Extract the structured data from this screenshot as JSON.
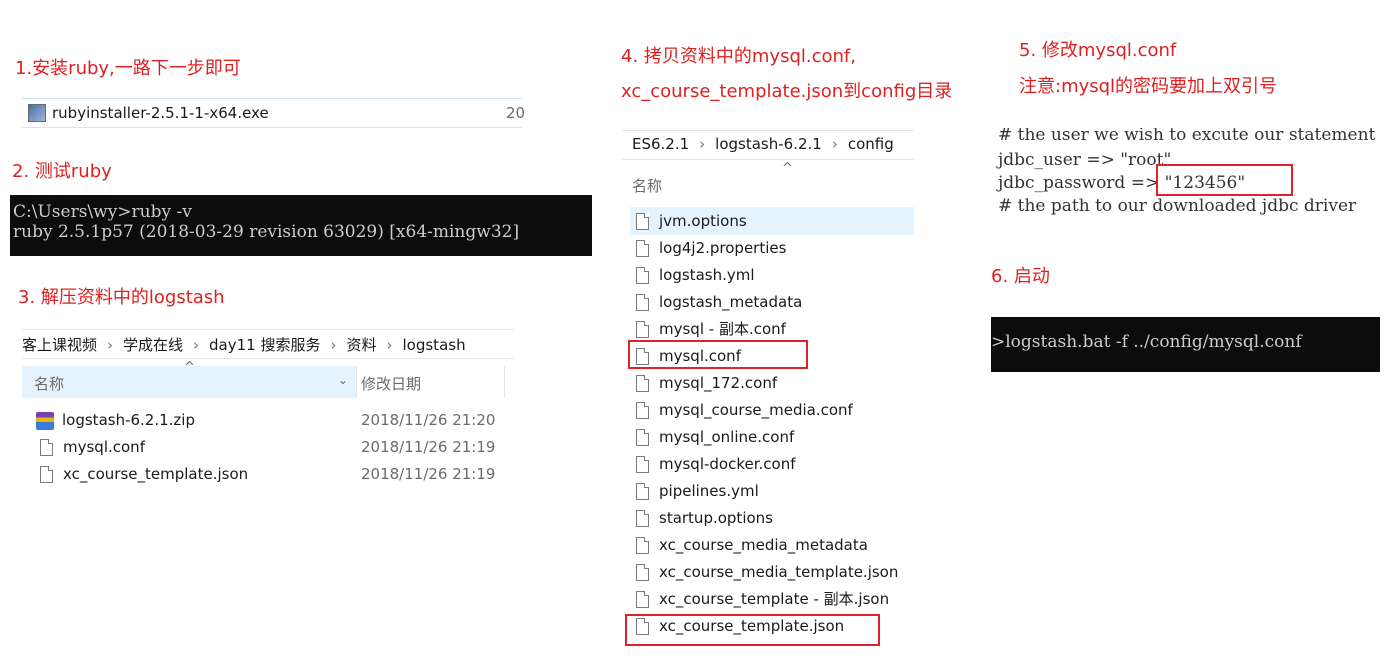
{
  "steps": {
    "s1": "1.安装ruby,一路下一步即可",
    "s2": "2. 测试ruby",
    "s3": "3. 解压资料中的logstash",
    "s4_line1": "4. 拷贝资料中的mysql.conf,",
    "s4_line2": "xc_course_template.json到config目录",
    "s5": "5. 修改mysql.conf",
    "s5_note": "注意:mysql的密码要加上双引号",
    "s6": "6. 启动"
  },
  "installer": {
    "file_name": "rubyinstaller-2.5.1-1-x64.exe",
    "date_partial": "20",
    "icon": "installer-icon"
  },
  "ruby_console": {
    "line1": "C:\\Users\\wy>ruby -v",
    "line2": "ruby 2.5.1p57 (2018-03-29 revision 63029) [x64-mingw32]"
  },
  "logstash_explorer": {
    "breadcrumb": [
      "客上课视频",
      "学成在线",
      "day11 搜索服务",
      "资料",
      "logstash"
    ],
    "columns": {
      "name": "名称",
      "modified": "修改日期"
    },
    "files": [
      {
        "name": "logstash-6.2.1.zip",
        "date": "2018/11/26 21:20",
        "icon": "zip-icon"
      },
      {
        "name": "mysql.conf",
        "date": "2018/11/26 21:19",
        "icon": "file-icon"
      },
      {
        "name": "xc_course_template.json",
        "date": "2018/11/26 21:19",
        "icon": "file-icon"
      }
    ]
  },
  "config_explorer": {
    "breadcrumb": [
      "ES6.2.1",
      "logstash-6.2.1",
      "config"
    ],
    "column_name": "名称",
    "files": [
      "jvm.options",
      "log4j2.properties",
      "logstash.yml",
      "logstash_metadata",
      "mysql - 副本.conf",
      "mysql.conf",
      "mysql_172.conf",
      "mysql_course_media.conf",
      "mysql_online.conf",
      "mysql-docker.conf",
      "pipelines.yml",
      "startup.options",
      "xc_course_media_metadata",
      "xc_course_media_template.json",
      "xc_course_template - 副本.json",
      "xc_course_template.json"
    ]
  },
  "config_snippet": {
    "line0": "# the user we wish to excute our statement",
    "line1": "jdbc_user => \"root\"",
    "line2_key": "jdbc_password => ",
    "line2_val": "\"123456\"",
    "line3": "# the path to our downloaded jdbc driver"
  },
  "start_console": {
    "command": ">logstash.bat -f ../config/mysql.conf"
  },
  "colors": {
    "accent_red": "#e02020",
    "selection": "#cce8ff",
    "console_bg": "#0c0c0c"
  }
}
